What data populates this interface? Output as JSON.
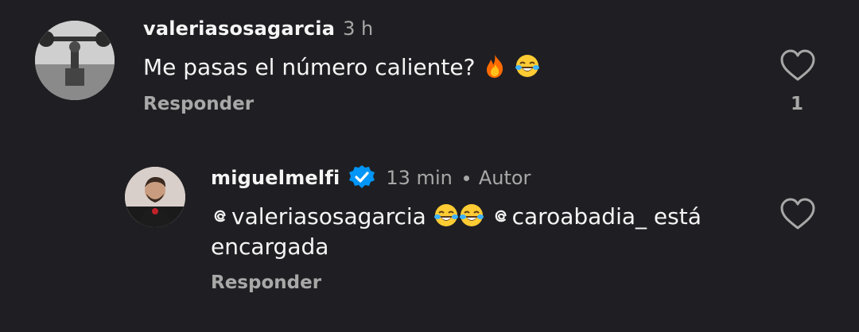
{
  "comments": [
    {
      "username": "valeriasosagarcia",
      "time": "3 h",
      "text_before": "Me pasas el número caliente? ",
      "emojis": [
        "fire-emoji",
        "tears-of-joy-emoji"
      ],
      "reply_label": "Responder",
      "likes": "1"
    },
    {
      "username": "miguelmelfi",
      "verified": true,
      "time": "13 min",
      "author_badge": "Autor",
      "mention1": "valeriasosagarcia",
      "mention2": "caroabadia_",
      "text_after": " está encargada",
      "reply_label": "Responder"
    }
  ],
  "colors": {
    "background": "#1f1f23",
    "primary_text": "#f5f5f5",
    "secondary_text": "#a8a8a8",
    "verified_blue": "#0095f6"
  },
  "icons": [
    "heart-outline-icon",
    "verified-badge-icon",
    "threads-mention-icon"
  ]
}
